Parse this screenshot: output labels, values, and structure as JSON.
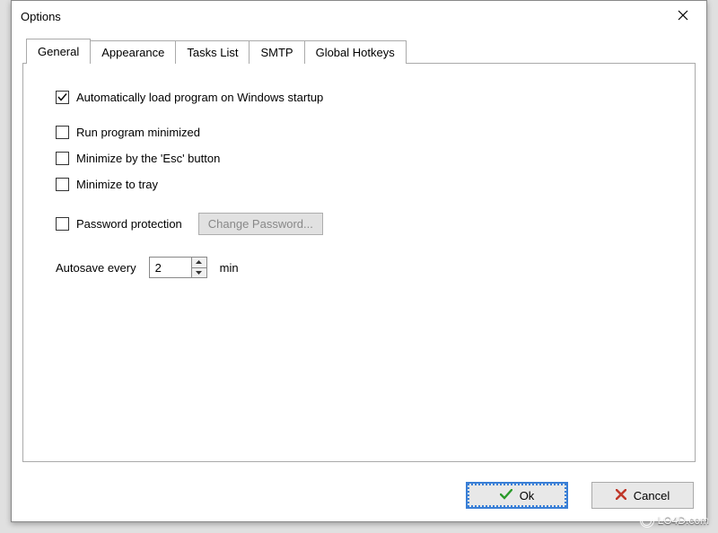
{
  "dialog": {
    "title": "Options"
  },
  "tabs": {
    "general": "General",
    "appearance": "Appearance",
    "tasks_list": "Tasks List",
    "smtp": "SMTP",
    "global_hotkeys": "Global Hotkeys"
  },
  "options": {
    "auto_startup": {
      "label": "Automatically load program on Windows startup",
      "checked": true
    },
    "run_minimized": {
      "label": "Run program minimized",
      "checked": false
    },
    "minimize_esc": {
      "label": "Minimize by the 'Esc' button",
      "checked": false
    },
    "minimize_tray": {
      "label": "Minimize to tray",
      "checked": false
    },
    "password_protection": {
      "label": "Password protection",
      "checked": false
    },
    "change_password_label": "Change Password...",
    "autosave_label": "Autosave every",
    "autosave_value": "2",
    "autosave_unit": "min"
  },
  "buttons": {
    "ok": "Ok",
    "cancel": "Cancel"
  },
  "watermark": "LO4D.com"
}
